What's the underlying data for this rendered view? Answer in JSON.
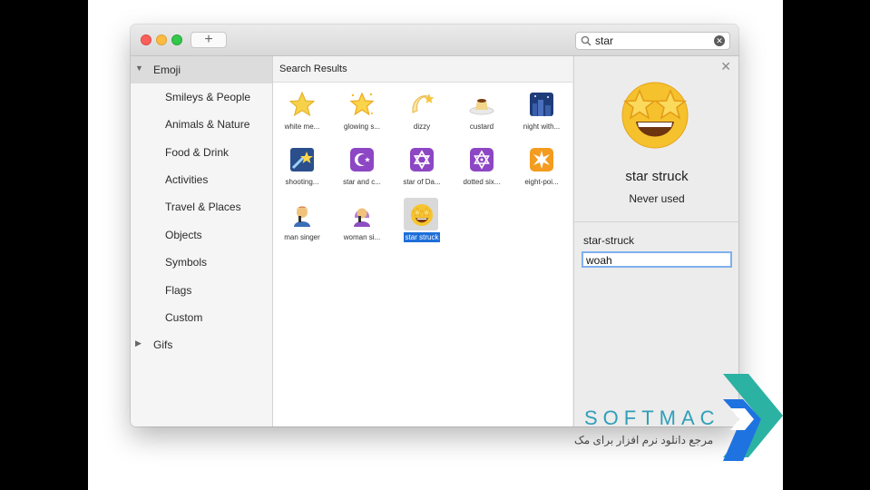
{
  "search": {
    "value": "star"
  },
  "sidebar": {
    "header": "Emoji",
    "items": [
      {
        "label": "Smileys & People"
      },
      {
        "label": "Animals & Nature"
      },
      {
        "label": "Food & Drink"
      },
      {
        "label": "Activities"
      },
      {
        "label": "Travel & Places"
      },
      {
        "label": "Objects"
      },
      {
        "label": "Symbols"
      },
      {
        "label": "Flags"
      },
      {
        "label": "Custom"
      }
    ],
    "gifs": "Gifs"
  },
  "results": {
    "header": "Search Results",
    "items": [
      {
        "label": "white me...",
        "icon": "white-star-icon"
      },
      {
        "label": "glowing s...",
        "icon": "glowing-star-icon"
      },
      {
        "label": "dizzy",
        "icon": "dizzy-icon"
      },
      {
        "label": "custard",
        "icon": "custard-icon"
      },
      {
        "label": "night with...",
        "icon": "night-with-stars-icon"
      },
      {
        "label": "shooting...",
        "icon": "shooting-star-icon"
      },
      {
        "label": "star and c...",
        "icon": "star-and-crescent-icon"
      },
      {
        "label": "star of Da...",
        "icon": "star-of-david-icon"
      },
      {
        "label": "dotted six...",
        "icon": "dotted-six-pointed-star-icon"
      },
      {
        "label": "eight-poi...",
        "icon": "eight-pointed-star-icon"
      },
      {
        "label": "man singer",
        "icon": "man-singer-icon"
      },
      {
        "label": "woman si...",
        "icon": "woman-singer-icon"
      },
      {
        "label": "star struck",
        "icon": "star-struck-icon",
        "selected": true
      }
    ]
  },
  "detail": {
    "name": "star struck",
    "usage": "Never used",
    "keyword_label": "star-struck",
    "keyword_value": "woah"
  },
  "branding": {
    "name": "SOFTMAC",
    "subtitle": "مرجع دانلود نرم افزار برای مک"
  },
  "colors": {
    "selection": "#1e6fd9",
    "brand": "#2f9fb8"
  }
}
